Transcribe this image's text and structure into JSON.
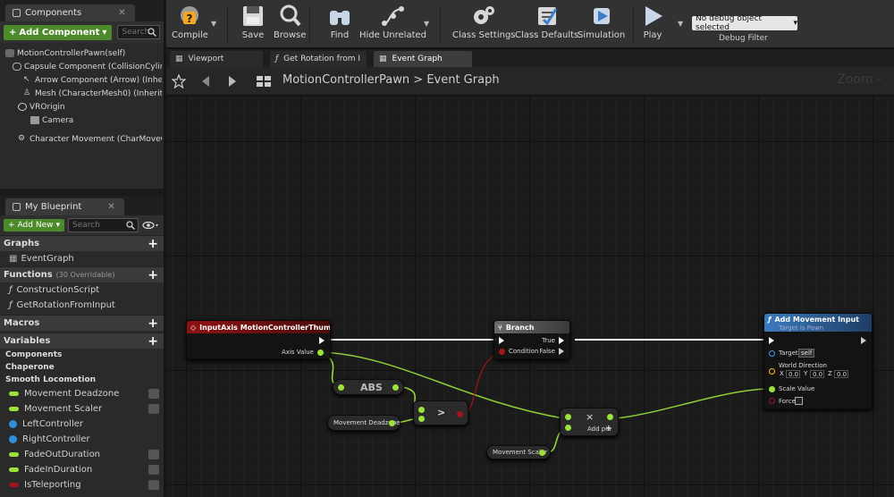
{
  "components_panel": {
    "tab_label": "Components",
    "add_button": "Add Component",
    "search_placeholder": "Search",
    "tree": [
      "MotionControllerPawn(self)",
      "Capsule Component (CollisionCylinde",
      "Arrow Component (Arrow) (Inherite",
      "Mesh (CharacterMesh0) (Inherited)",
      "VROrigin",
      "Camera",
      "Character Movement (CharMoveCom"
    ]
  },
  "my_blueprint": {
    "tab_label": "My Blueprint",
    "add_button": "Add New",
    "search_placeholder": "Search",
    "graphs_label": "Graphs",
    "event_graph": "EventGraph",
    "functions_label": "Functions",
    "functions_sub": "(30 Overridable)",
    "functions": [
      "ConstructionScript",
      "GetRotationFromInput"
    ],
    "macros_label": "Macros",
    "variables_label": "Variables",
    "categories": [
      "Components",
      "Chaperone",
      "Smooth Locomotion"
    ],
    "variables": [
      {
        "name": "Movement Deadzone",
        "color": "#9be23b",
        "kind": "pill"
      },
      {
        "name": "Movement Scaler",
        "color": "#9be23b",
        "kind": "pill"
      },
      {
        "name": "LeftController",
        "color": "#2f8fd8",
        "kind": "dot"
      },
      {
        "name": "RightController",
        "color": "#2f8fd8",
        "kind": "dot"
      },
      {
        "name": "FadeOutDuration",
        "color": "#9be23b",
        "kind": "pill"
      },
      {
        "name": "FadeInDuration",
        "color": "#9be23b",
        "kind": "pill"
      },
      {
        "name": "IsTeleporting",
        "color": "#a1141b",
        "kind": "pill"
      }
    ]
  },
  "toolbar": {
    "compile": "Compile",
    "save": "Save",
    "browse": "Browse",
    "find": "Find",
    "hide_unrelated": "Hide Unrelated",
    "class_settings": "Class Settings",
    "class_defaults": "Class Defaults",
    "simulation": "Simulation",
    "play": "Play",
    "debug_object": "No debug object selected",
    "debug_filter": "Debug Filter"
  },
  "doc_tabs": [
    "Viewport",
    "Get Rotation from I",
    "Event Graph"
  ],
  "breadcrumb": {
    "blueprint": "MotionControllerPawn",
    "separator": ">",
    "graph": "Event Graph",
    "zoom": "Zoom -"
  },
  "nodes": {
    "input_axis": {
      "title": "InputAxis MotionControllerThumbLeft_X",
      "pin": "Axis Value"
    },
    "abs": {
      "title": "ABS"
    },
    "deadzone_getter": {
      "title": "Movement Deadzone"
    },
    "compare": {
      "op": ">"
    },
    "branch": {
      "title": "Branch",
      "condition": "Condition",
      "true": "True",
      "false": "False"
    },
    "multiply": {
      "op": "×",
      "add_pin": "Add pin"
    },
    "scaler_getter": {
      "title": "Movement Scaler"
    },
    "add_movement": {
      "title": "Add Movement Input",
      "subtitle": "Target is Pawn",
      "target": "Target",
      "target_value": "self",
      "world_direction": "World Direction",
      "x_label": "X",
      "x": "0.0",
      "y_label": "Y",
      "y": "0.0",
      "z_label": "Z",
      "z": "0.0",
      "scale_value": "Scale Value",
      "force": "Force"
    }
  }
}
